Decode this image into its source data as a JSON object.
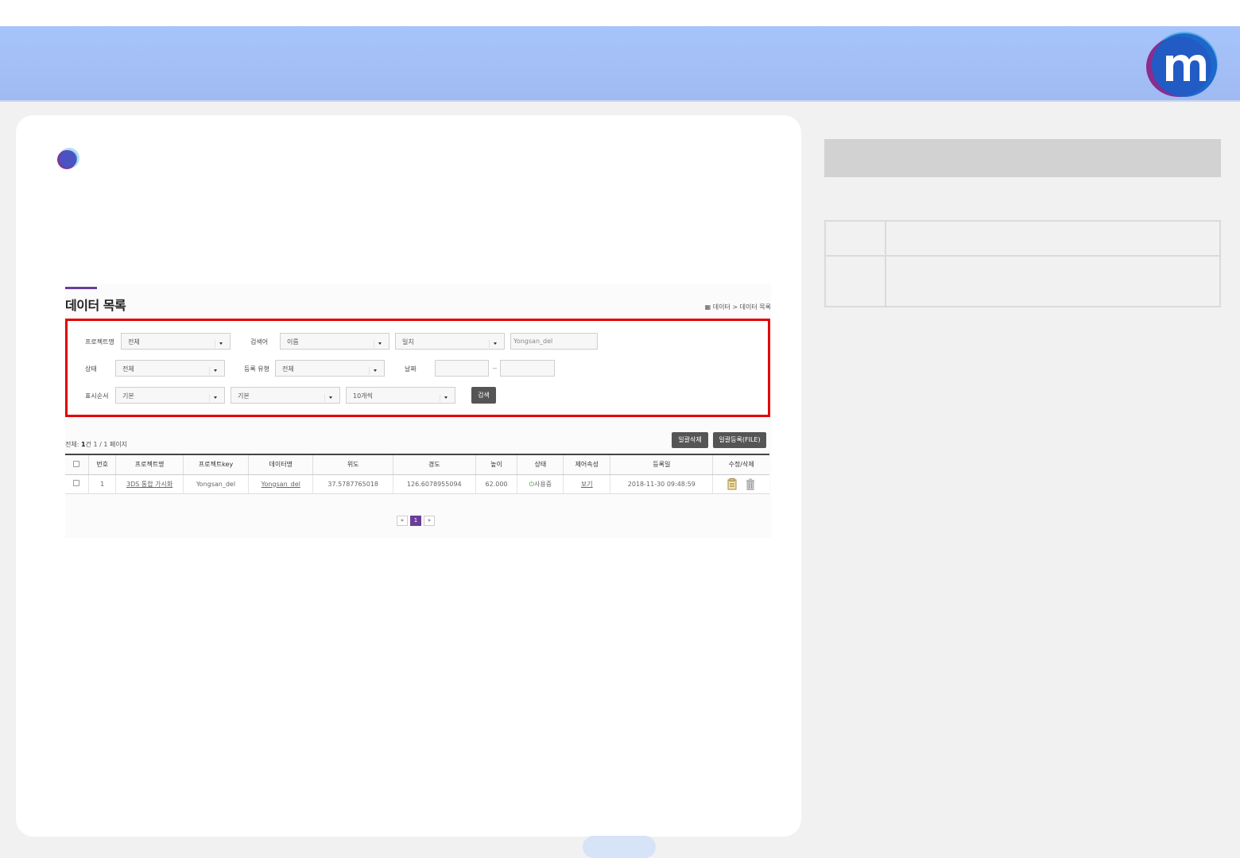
{
  "section": {
    "title": "데이터 목록",
    "breadcrumb": "데이터 > 데이터 목록"
  },
  "search": {
    "project_label": "프로젝트명",
    "project_value": "전체",
    "keyword_label": "검색어",
    "keyword_field_value": "이름",
    "keyword_match_value": "일치",
    "keyword_input_value": "Yongsan_del",
    "status_label": "상태",
    "status_value": "전체",
    "regtype_label": "등록 유형",
    "regtype_value": "전체",
    "date_label": "날짜",
    "date_sep": "~",
    "order_label": "표시순서",
    "order_field_value": "기본",
    "order_dir_value": "기본",
    "page_size_value": "10개씩",
    "search_button": "검색"
  },
  "list": {
    "count_prefix": "전체: ",
    "count_num": "1",
    "count_suffix": "건 1 / 1 페이지",
    "bulk_delete_button": "일괄삭제",
    "bulk_upload_button": "일괄등록(FILE)",
    "columns": [
      "번호",
      "프로젝트명",
      "프로젝트key",
      "데이터명",
      "위도",
      "경도",
      "높이",
      "상태",
      "제어속성",
      "등록일",
      "수정/삭제"
    ],
    "rows": [
      {
        "no": "1",
        "project": "3DS 통합 가시화",
        "project_key": "Yongsan_del",
        "data_name": "Yongsan_del",
        "lat": "37.5787765018",
        "lon": "126.6078955094",
        "height": "62.000",
        "status": "사용중",
        "control": "보기",
        "date": "2018-11-30 09:48:59"
      }
    ]
  },
  "pagination": {
    "first": "«",
    "current": "1",
    "last": "»"
  },
  "colors": {
    "banner": "#a6c3fb",
    "accent": "#6a3d9a",
    "highlight_border": "#e30000",
    "status_green": "#1aa51a"
  },
  "icons": [
    "logo-m-icon",
    "bullet-circle-icon",
    "grid-icon",
    "power-icon",
    "edit-icon",
    "trash-icon"
  ]
}
